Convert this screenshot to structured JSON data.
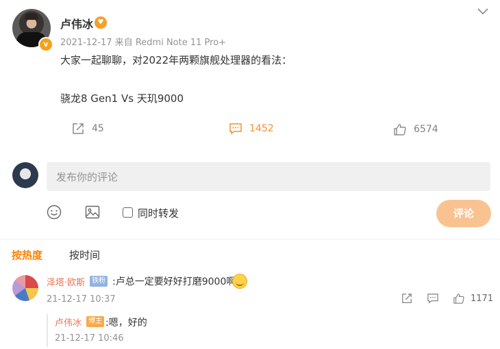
{
  "post": {
    "author": "卢伟冰",
    "verified_icon": "v-icon",
    "date": "2021-12-17",
    "source": "来自 Redmi Note 11 Pro+",
    "text_line1": "大家一起聊聊，对2022年两颗旗舰处理器的看法：",
    "text_line2": "骁龙8 Gen1 Vs 天玑9000",
    "repost_count": "45",
    "comment_count": "1452",
    "like_count": "6574"
  },
  "composer": {
    "placeholder": "发布你的评论",
    "repost_label": "同时转发",
    "submit_label": "评论"
  },
  "sort": {
    "hot": "按热度",
    "time": "按时间"
  },
  "comment": {
    "user": "泽塔·欧斯",
    "badge": "铁粉",
    "text": ":卢总一定要好好打磨9000啊",
    "time": "21-12-17 10:37",
    "like_count": "1171",
    "reply": {
      "user": "卢伟冰",
      "badge": "博主",
      "text": ":嗯，好的",
      "time": "21-12-17 10:46"
    }
  },
  "colors": {
    "accent_orange": "#ff8200",
    "username_link": "#eb7350",
    "submit_button_disabled": "#f9c391"
  }
}
